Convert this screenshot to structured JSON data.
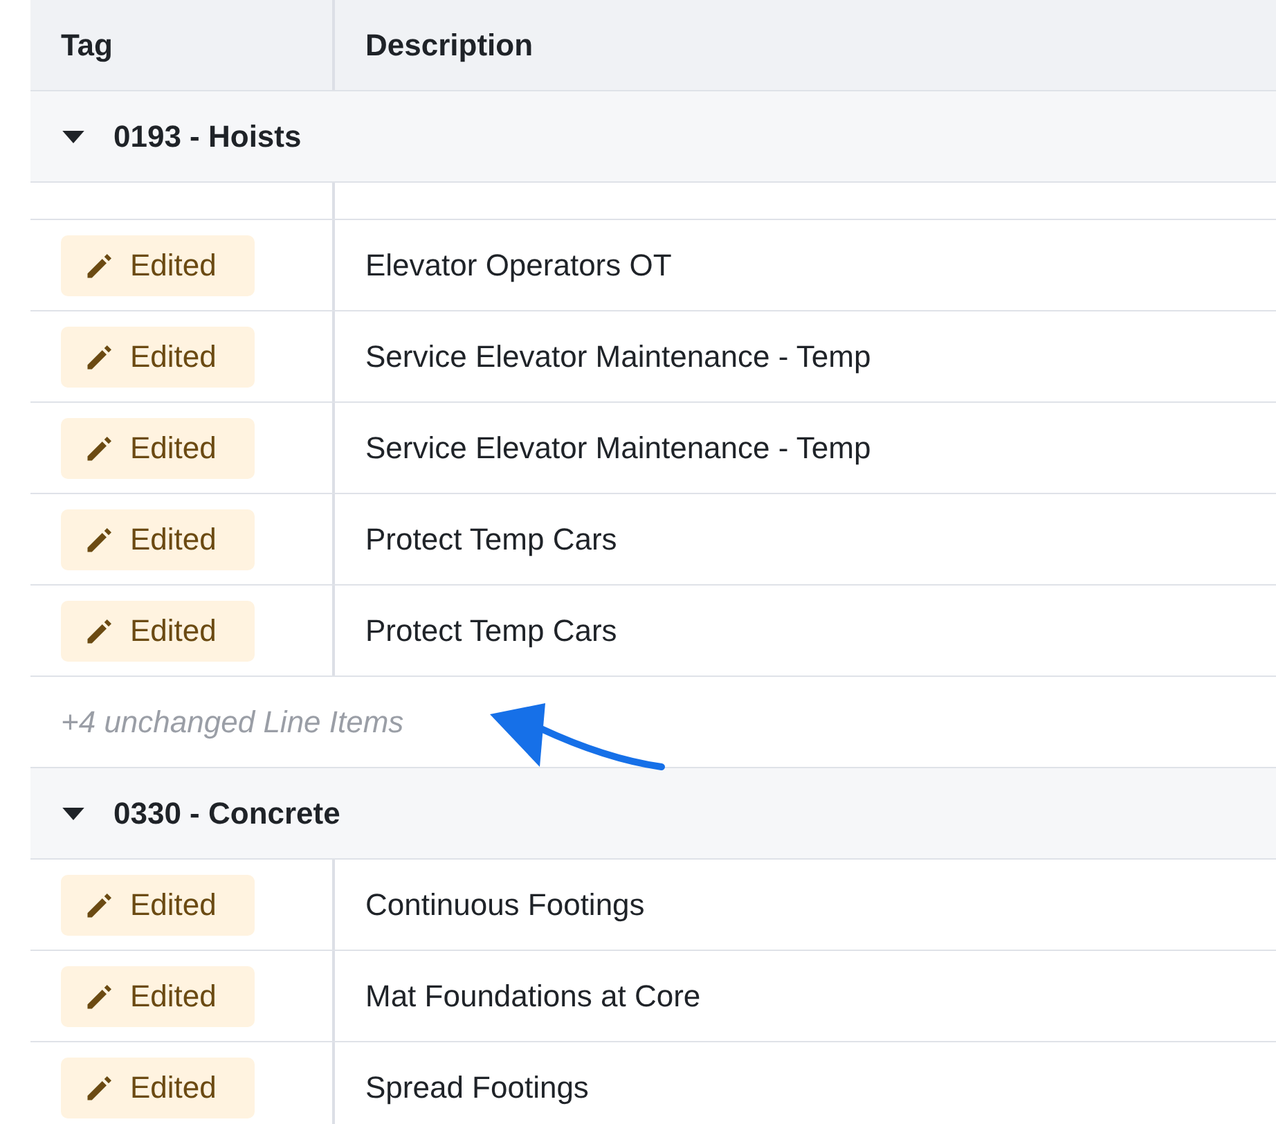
{
  "table": {
    "columns": [
      {
        "label": "Tag"
      },
      {
        "label": "Description"
      }
    ],
    "rows": [
      {
        "kind": "group",
        "label": "0193 - Hoists",
        "expanded": true
      },
      {
        "kind": "gap"
      },
      {
        "kind": "item",
        "tag": "Edited",
        "description": "Elevator Operators OT"
      },
      {
        "kind": "item",
        "tag": "Edited",
        "description": "Service Elevator Maintenance - Temp"
      },
      {
        "kind": "item",
        "tag": "Edited",
        "description": "Service Elevator Maintenance - Temp"
      },
      {
        "kind": "item",
        "tag": "Edited",
        "description": "Protect Temp Cars"
      },
      {
        "kind": "item",
        "tag": "Edited",
        "description": "Protect Temp Cars"
      },
      {
        "kind": "unchanged",
        "label": "+4 unchanged Line Items"
      },
      {
        "kind": "group",
        "label": "0330 - Concrete",
        "expanded": true
      },
      {
        "kind": "item",
        "tag": "Edited",
        "description": "Continuous Footings"
      },
      {
        "kind": "item",
        "tag": "Edited",
        "description": "Mat Foundations at Core"
      },
      {
        "kind": "item",
        "tag": "Edited",
        "description": "Spread Footings"
      }
    ]
  }
}
